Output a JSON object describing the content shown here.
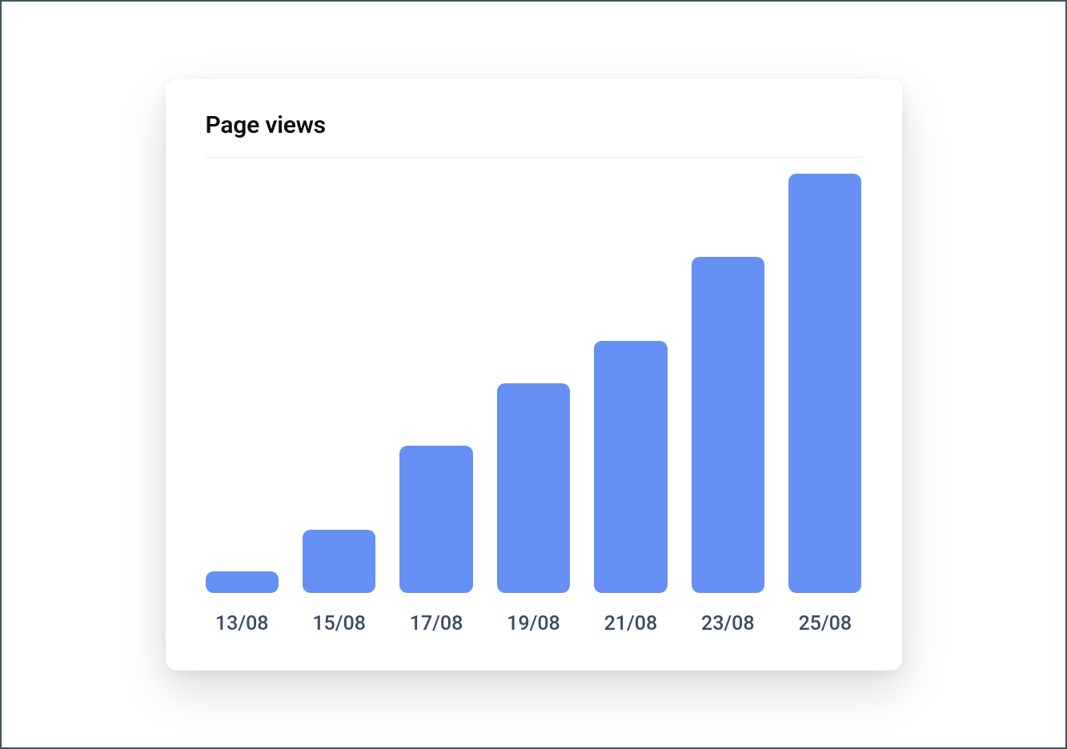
{
  "title": "Page views",
  "chart_data": {
    "type": "bar",
    "title": "Page views",
    "xlabel": "",
    "ylabel": "",
    "categories": [
      "13/08",
      "15/08",
      "17/08",
      "19/08",
      "21/08",
      "23/08",
      "25/08"
    ],
    "values": [
      5,
      15,
      35,
      50,
      60,
      80,
      100
    ],
    "ylim": [
      0,
      100
    ],
    "color": "#6690f4"
  }
}
